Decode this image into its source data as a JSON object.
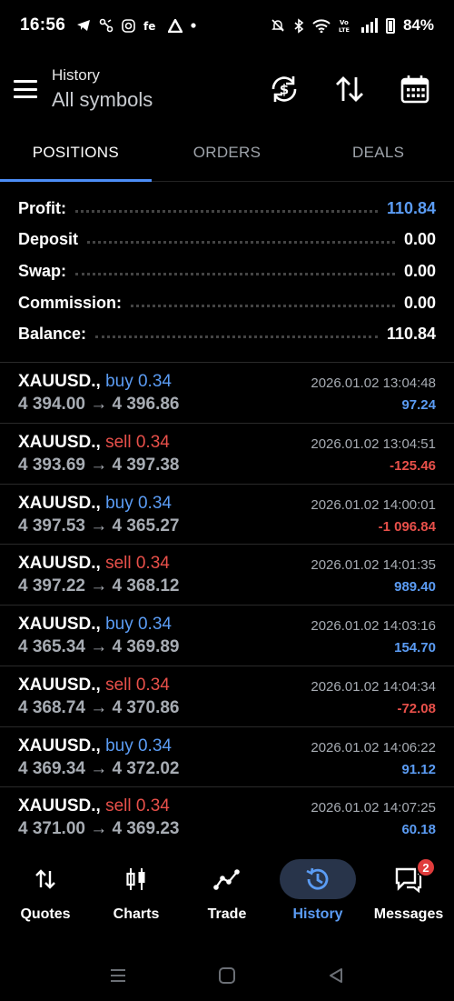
{
  "status_bar": {
    "time": "16:56",
    "battery": "84%",
    "left_icons": [
      "telegram-icon",
      "fork-icon",
      "instagram-icon",
      "edge-icon",
      "app-icon",
      "dot-icon"
    ],
    "right_icons": [
      "mute-icon",
      "bluetooth-icon",
      "wifi-icon",
      "volte-icon",
      "signal-icon",
      "battery-icon"
    ]
  },
  "header": {
    "title": "History",
    "subtitle": "All symbols",
    "actions": [
      "currency-refresh-icon",
      "sort-icon",
      "calendar-icon"
    ]
  },
  "tabs": [
    {
      "label": "POSITIONS",
      "active": true
    },
    {
      "label": "ORDERS",
      "active": false
    },
    {
      "label": "DEALS",
      "active": false
    }
  ],
  "summary": [
    {
      "label": "Profit:",
      "value": "110.84",
      "accent": true
    },
    {
      "label": "Deposit",
      "value": "0.00",
      "accent": false
    },
    {
      "label": "Swap:",
      "value": "0.00",
      "accent": false
    },
    {
      "label": "Commission:",
      "value": "0.00",
      "accent": false
    },
    {
      "label": "Balance:",
      "value": "110.84",
      "accent": false
    }
  ],
  "deals": [
    {
      "symbol": "XAUUSD.,",
      "side": "buy 0.34",
      "side_type": "buy",
      "prices": "4 394.00 → 4 396.86",
      "time": "2026.01.02 13:04:48",
      "profit": "97.24",
      "profit_positive": true
    },
    {
      "symbol": "XAUUSD.,",
      "side": "sell 0.34",
      "side_type": "sell",
      "prices": "4 393.69 → 4 397.38",
      "time": "2026.01.02 13:04:51",
      "profit": "-125.46",
      "profit_positive": false
    },
    {
      "symbol": "XAUUSD.,",
      "side": "buy 0.34",
      "side_type": "buy",
      "prices": "4 397.53 → 4 365.27",
      "time": "2026.01.02 14:00:01",
      "profit": "-1 096.84",
      "profit_positive": false
    },
    {
      "symbol": "XAUUSD.,",
      "side": "sell 0.34",
      "side_type": "sell",
      "prices": "4 397.22 → 4 368.12",
      "time": "2026.01.02 14:01:35",
      "profit": "989.40",
      "profit_positive": true
    },
    {
      "symbol": "XAUUSD.,",
      "side": "buy 0.34",
      "side_type": "buy",
      "prices": "4 365.34 → 4 369.89",
      "time": "2026.01.02 14:03:16",
      "profit": "154.70",
      "profit_positive": true
    },
    {
      "symbol": "XAUUSD.,",
      "side": "sell 0.34",
      "side_type": "sell",
      "prices": "4 368.74 → 4 370.86",
      "time": "2026.01.02 14:04:34",
      "profit": "-72.08",
      "profit_positive": false
    },
    {
      "symbol": "XAUUSD.,",
      "side": "buy 0.34",
      "side_type": "buy",
      "prices": "4 369.34 → 4 372.02",
      "time": "2026.01.02 14:06:22",
      "profit": "91.12",
      "profit_positive": true
    },
    {
      "symbol": "XAUUSD.,",
      "side": "sell 0.34",
      "side_type": "sell",
      "prices": "4 371.00 → 4 369.23",
      "time": "2026.01.02 14:07:25",
      "profit": "60.18",
      "profit_positive": true
    }
  ],
  "bottom_nav": [
    {
      "label": "Quotes",
      "icon": "quotes-icon",
      "active": false
    },
    {
      "label": "Charts",
      "icon": "charts-icon",
      "active": false
    },
    {
      "label": "Trade",
      "icon": "trade-icon",
      "active": false
    },
    {
      "label": "History",
      "icon": "history-icon",
      "active": true
    },
    {
      "label": "Messages",
      "icon": "messages-icon",
      "active": false,
      "badge": "2"
    }
  ],
  "system_nav": [
    "recents-icon",
    "home-icon",
    "back-icon"
  ],
  "colors": {
    "accent": "#5b9cf4",
    "negative": "#e8504a",
    "background": "#000000",
    "muted_text": "#a7acb3"
  }
}
